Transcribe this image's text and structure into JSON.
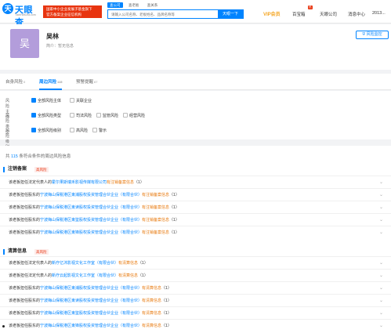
{
  "header": {
    "logo_mark": "天",
    "logo_text": "天眼查",
    "logo_sub": "TianYanCha.com",
    "banner_line1": "国家中小企业发展子基金旗下",
    "banner_line2": "官方备案企业征信机构",
    "search_tabs": [
      "查公司",
      "查老板",
      "查关系"
    ],
    "search_placeholder": "请输入公司名称、老板姓名、品牌名称等",
    "search_button": "天眼一下",
    "vip": "VIP会员",
    "hot_badge": "热",
    "nav_items": [
      "百宝箱",
      "天眼公司",
      "消息中心",
      "2013..."
    ]
  },
  "profile": {
    "avatar_char": "吴",
    "name": "吴林",
    "desc_label": "简介：",
    "desc_value": "暂无信息",
    "monitor_button": "风险监控"
  },
  "tabs": [
    {
      "label": "自身风险",
      "count": "0"
    },
    {
      "label": "周边风险",
      "count": "115"
    },
    {
      "label": "预警提醒",
      "count": "67"
    }
  ],
  "filters": {
    "subject": {
      "label": "风险主体",
      "options": [
        "全部风险主体",
        "关联企业"
      ]
    },
    "type": {
      "label": "风险类型",
      "options": [
        "全部风险类型",
        "司法风险",
        "监管风险",
        "经营风险"
      ]
    },
    "level": {
      "label": "风险级别",
      "options": [
        "全部风险级别",
        "高风险",
        "警示"
      ]
    }
  },
  "results": {
    "count_prefix": "共",
    "count": "115",
    "count_suffix": "条符合条件的周边风险信息",
    "sections": [
      {
        "title": "注销备案",
        "tag": "高风险",
        "rows": [
          {
            "prefix": "该老板担任法定代表人的",
            "company": "霍尔果斯瑞禾影视传媒有限公司",
            "reason": "有注销备案信息",
            "count": "（1）"
          },
          {
            "prefix": "该老板担任股东的",
            "company": "宁波梅山保税港区東浦股权投资管理合伙企业（有限合伙）",
            "reason": "有注销备案信息",
            "count": "（1）"
          },
          {
            "prefix": "该老板担任股东的",
            "company": "宁波梅山保税港区東读股权投资管理合伙企业（有限合伙）",
            "reason": "有注销备案信息",
            "count": "（1）"
          },
          {
            "prefix": "该老板担任股东的",
            "company": "宁波梅山保税港区東鉴股权投资管理合伙企业（有限合伙）",
            "reason": "有注销备案信息",
            "count": "（1）"
          },
          {
            "prefix": "该老板担任股东的",
            "company": "宁波梅山保税港区東锋股权投资管理合伙企业（有限合伙）",
            "reason": "有注销备案信息",
            "count": "（1）"
          }
        ]
      },
      {
        "title": "清算信息",
        "tag": "高风险",
        "rows": [
          {
            "prefix": "该老板担任法定代表人的",
            "company": "新疗亿沐影视文化工作室（有限合伙）",
            "reason": "有清算信息",
            "count": "（1）"
          },
          {
            "prefix": "该老板担任法定代表人的",
            "company": "新疗云起影视文化工作室（有限合伙）",
            "reason": "有清算信息",
            "count": "（1）"
          },
          {
            "prefix": "该老板担任股东的",
            "company": "宁波梅山保税港区東浦股权投资管理合伙企业（有限合伙）",
            "reason": "有清算信息",
            "count": "（1）"
          },
          {
            "prefix": "该老板担任股东的",
            "company": "宁波梅山保税港区東读股权投资管理合伙企业（有限合伙）",
            "reason": "有清算信息",
            "count": "（1）"
          },
          {
            "prefix": "该老板担任股东的",
            "company": "宁波梅山保税港区東鉴股权投资管理合伙企业（有限合伙）",
            "reason": "有清算信息",
            "count": "（1）"
          },
          {
            "prefix": "该老板担任股东的",
            "company": "宁波梅山保税港区東锋股权投资管理合伙企业（有限合伙）",
            "reason": "有清算信息",
            "count": "（1）"
          }
        ]
      }
    ]
  },
  "colors": {
    "accent": "#0084ff",
    "danger": "#e8340f",
    "warning": "#e87a0f",
    "vip": "#f5a623"
  }
}
